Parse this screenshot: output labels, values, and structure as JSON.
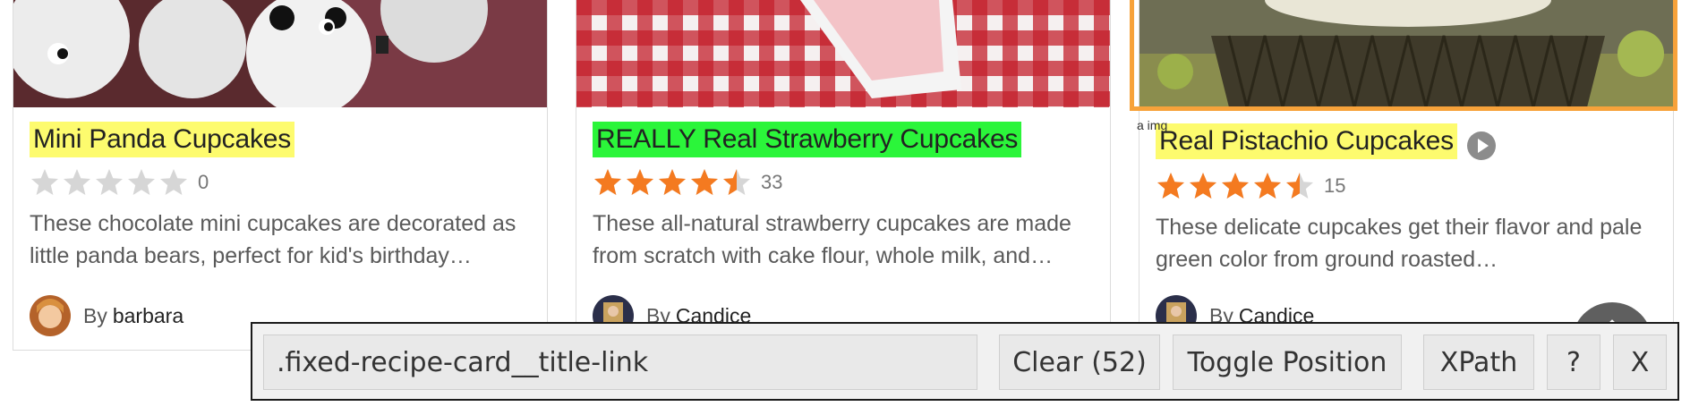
{
  "cards": [
    {
      "title": "Mini Panda Cupcakes",
      "rating_count": "0",
      "rating_value": 0,
      "description": "These chocolate mini cupcakes are decorated as little panda bears, perfect for kid's birthday…",
      "by_label": "By",
      "author": "barbara"
    },
    {
      "title": "REALLY Real Strawberry Cupcakes",
      "rating_count": "33",
      "rating_value": 4.5,
      "description": "These all-natural strawberry cupcakes are made from scratch with cake flour, whole milk, and…",
      "by_label": "By",
      "author": "Candice"
    },
    {
      "title": "Real Pistachio Cupcakes",
      "rating_count": "15",
      "rating_value": 4.5,
      "description": "These delicate cupcakes get their flavor and pale green color from ground roasted…",
      "by_label": "By",
      "author": "Candice"
    }
  ],
  "highlight_label": "a img",
  "toolbar": {
    "selector_value": ".fixed-recipe-card__title-link",
    "clear_label": "Clear (52)",
    "toggle_label": "Toggle Position",
    "xpath_label": "XPath",
    "help_label": "?",
    "close_label": "X"
  },
  "colors": {
    "star_filled": "#f47a20",
    "star_empty": "#d6d6d6",
    "highlight_yellow": "#fdfb6e",
    "highlight_green": "#2bf53a",
    "highlight_box": "#f7a23a"
  }
}
